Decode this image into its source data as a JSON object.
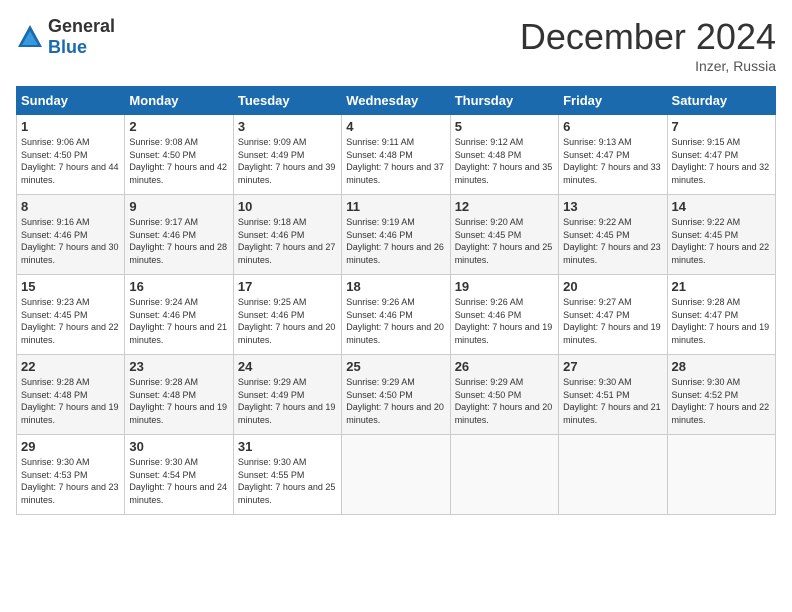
{
  "header": {
    "logo_general": "General",
    "logo_blue": "Blue",
    "title": "December 2024",
    "location": "Inzer, Russia"
  },
  "days_of_week": [
    "Sunday",
    "Monday",
    "Tuesday",
    "Wednesday",
    "Thursday",
    "Friday",
    "Saturday"
  ],
  "weeks": [
    [
      {
        "day": "1",
        "sunrise": "Sunrise: 9:06 AM",
        "sunset": "Sunset: 4:50 PM",
        "daylight": "Daylight: 7 hours and 44 minutes."
      },
      {
        "day": "2",
        "sunrise": "Sunrise: 9:08 AM",
        "sunset": "Sunset: 4:50 PM",
        "daylight": "Daylight: 7 hours and 42 minutes."
      },
      {
        "day": "3",
        "sunrise": "Sunrise: 9:09 AM",
        "sunset": "Sunset: 4:49 PM",
        "daylight": "Daylight: 7 hours and 39 minutes."
      },
      {
        "day": "4",
        "sunrise": "Sunrise: 9:11 AM",
        "sunset": "Sunset: 4:48 PM",
        "daylight": "Daylight: 7 hours and 37 minutes."
      },
      {
        "day": "5",
        "sunrise": "Sunrise: 9:12 AM",
        "sunset": "Sunset: 4:48 PM",
        "daylight": "Daylight: 7 hours and 35 minutes."
      },
      {
        "day": "6",
        "sunrise": "Sunrise: 9:13 AM",
        "sunset": "Sunset: 4:47 PM",
        "daylight": "Daylight: 7 hours and 33 minutes."
      },
      {
        "day": "7",
        "sunrise": "Sunrise: 9:15 AM",
        "sunset": "Sunset: 4:47 PM",
        "daylight": "Daylight: 7 hours and 32 minutes."
      }
    ],
    [
      {
        "day": "8",
        "sunrise": "Sunrise: 9:16 AM",
        "sunset": "Sunset: 4:46 PM",
        "daylight": "Daylight: 7 hours and 30 minutes."
      },
      {
        "day": "9",
        "sunrise": "Sunrise: 9:17 AM",
        "sunset": "Sunset: 4:46 PM",
        "daylight": "Daylight: 7 hours and 28 minutes."
      },
      {
        "day": "10",
        "sunrise": "Sunrise: 9:18 AM",
        "sunset": "Sunset: 4:46 PM",
        "daylight": "Daylight: 7 hours and 27 minutes."
      },
      {
        "day": "11",
        "sunrise": "Sunrise: 9:19 AM",
        "sunset": "Sunset: 4:46 PM",
        "daylight": "Daylight: 7 hours and 26 minutes."
      },
      {
        "day": "12",
        "sunrise": "Sunrise: 9:20 AM",
        "sunset": "Sunset: 4:45 PM",
        "daylight": "Daylight: 7 hours and 25 minutes."
      },
      {
        "day": "13",
        "sunrise": "Sunrise: 9:22 AM",
        "sunset": "Sunset: 4:45 PM",
        "daylight": "Daylight: 7 hours and 23 minutes."
      },
      {
        "day": "14",
        "sunrise": "Sunrise: 9:22 AM",
        "sunset": "Sunset: 4:45 PM",
        "daylight": "Daylight: 7 hours and 22 minutes."
      }
    ],
    [
      {
        "day": "15",
        "sunrise": "Sunrise: 9:23 AM",
        "sunset": "Sunset: 4:45 PM",
        "daylight": "Daylight: 7 hours and 22 minutes."
      },
      {
        "day": "16",
        "sunrise": "Sunrise: 9:24 AM",
        "sunset": "Sunset: 4:46 PM",
        "daylight": "Daylight: 7 hours and 21 minutes."
      },
      {
        "day": "17",
        "sunrise": "Sunrise: 9:25 AM",
        "sunset": "Sunset: 4:46 PM",
        "daylight": "Daylight: 7 hours and 20 minutes."
      },
      {
        "day": "18",
        "sunrise": "Sunrise: 9:26 AM",
        "sunset": "Sunset: 4:46 PM",
        "daylight": "Daylight: 7 hours and 20 minutes."
      },
      {
        "day": "19",
        "sunrise": "Sunrise: 9:26 AM",
        "sunset": "Sunset: 4:46 PM",
        "daylight": "Daylight: 7 hours and 19 minutes."
      },
      {
        "day": "20",
        "sunrise": "Sunrise: 9:27 AM",
        "sunset": "Sunset: 4:47 PM",
        "daylight": "Daylight: 7 hours and 19 minutes."
      },
      {
        "day": "21",
        "sunrise": "Sunrise: 9:28 AM",
        "sunset": "Sunset: 4:47 PM",
        "daylight": "Daylight: 7 hours and 19 minutes."
      }
    ],
    [
      {
        "day": "22",
        "sunrise": "Sunrise: 9:28 AM",
        "sunset": "Sunset: 4:48 PM",
        "daylight": "Daylight: 7 hours and 19 minutes."
      },
      {
        "day": "23",
        "sunrise": "Sunrise: 9:28 AM",
        "sunset": "Sunset: 4:48 PM",
        "daylight": "Daylight: 7 hours and 19 minutes."
      },
      {
        "day": "24",
        "sunrise": "Sunrise: 9:29 AM",
        "sunset": "Sunset: 4:49 PM",
        "daylight": "Daylight: 7 hours and 19 minutes."
      },
      {
        "day": "25",
        "sunrise": "Sunrise: 9:29 AM",
        "sunset": "Sunset: 4:50 PM",
        "daylight": "Daylight: 7 hours and 20 minutes."
      },
      {
        "day": "26",
        "sunrise": "Sunrise: 9:29 AM",
        "sunset": "Sunset: 4:50 PM",
        "daylight": "Daylight: 7 hours and 20 minutes."
      },
      {
        "day": "27",
        "sunrise": "Sunrise: 9:30 AM",
        "sunset": "Sunset: 4:51 PM",
        "daylight": "Daylight: 7 hours and 21 minutes."
      },
      {
        "day": "28",
        "sunrise": "Sunrise: 9:30 AM",
        "sunset": "Sunset: 4:52 PM",
        "daylight": "Daylight: 7 hours and 22 minutes."
      }
    ],
    [
      {
        "day": "29",
        "sunrise": "Sunrise: 9:30 AM",
        "sunset": "Sunset: 4:53 PM",
        "daylight": "Daylight: 7 hours and 23 minutes."
      },
      {
        "day": "30",
        "sunrise": "Sunrise: 9:30 AM",
        "sunset": "Sunset: 4:54 PM",
        "daylight": "Daylight: 7 hours and 24 minutes."
      },
      {
        "day": "31",
        "sunrise": "Sunrise: 9:30 AM",
        "sunset": "Sunset: 4:55 PM",
        "daylight": "Daylight: 7 hours and 25 minutes."
      },
      null,
      null,
      null,
      null
    ]
  ]
}
